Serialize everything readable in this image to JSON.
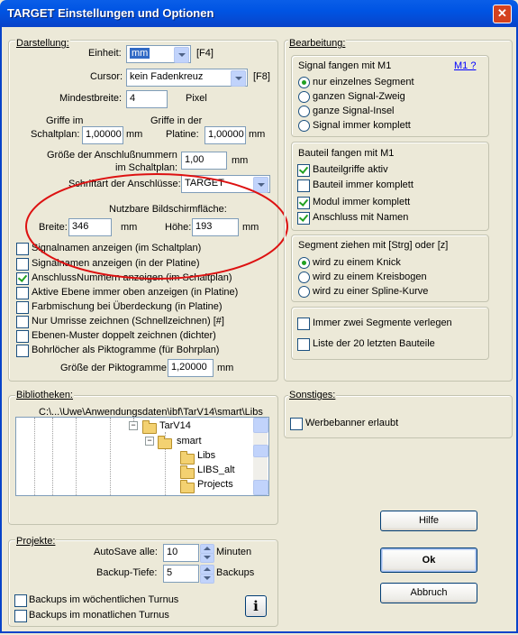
{
  "window": {
    "title": "TARGET Einstellungen und Optionen",
    "close_glyph": "✕"
  },
  "darstellung": {
    "label": "Darstellung:",
    "einheit_label": "Einheit:",
    "einheit_value": "mm",
    "einheit_key": "[F4]",
    "cursor_label": "Cursor:",
    "cursor_value": "kein Fadenkreuz",
    "cursor_key": "[F8]",
    "mindestbreite_label": "Mindestbreite:",
    "mindestbreite_value": "4",
    "mindestbreite_unit": "Pixel",
    "griffe_schaltplan_label1": "Griffe im",
    "griffe_schaltplan_label2": "Schaltplan:",
    "griffe_schaltplan_value": "1,00000",
    "griffe_schaltplan_unit": "mm",
    "griffe_platine_label1": "Griffe in der",
    "griffe_platine_label2": "Platine:",
    "griffe_platine_value": "1,00000",
    "griffe_platine_unit": "mm",
    "anschluss_groesse_label1": "Größe der Anschlußnummern",
    "anschluss_groesse_label2": "im Schaltplan:",
    "anschluss_groesse_value": "1,00",
    "anschluss_groesse_unit": "mm",
    "schriftart_label": "Schriftart der Anschlüsse:",
    "schriftart_value": "TARGET",
    "nutzbar_label": "Nutzbare Bildschirmfläche:",
    "breite_label": "Breite:",
    "breite_value": "346",
    "breite_unit": "mm",
    "hoehe_label": "Höhe:",
    "hoehe_value": "193",
    "hoehe_unit": "mm",
    "checkboxes": [
      {
        "label": "Signalnamen anzeigen (im Schaltplan)",
        "checked": false
      },
      {
        "label": "Signalnamen anzeigen (in der Platine)",
        "checked": false
      },
      {
        "label": "AnschlussNummern anzeigen (im Schaltplan)",
        "checked": true
      },
      {
        "label": "Aktive Ebene immer oben anzeigen (in Platine)",
        "checked": false
      },
      {
        "label": "Farbmischung bei Überdeckung (in Platine)",
        "checked": false
      },
      {
        "label": "Nur Umrisse zeichnen (Schnellzeichnen)  [#]",
        "checked": false
      },
      {
        "label": "Ebenen-Muster doppelt zeichnen (dichter)",
        "checked": false
      },
      {
        "label": "Bohrlöcher als Piktogramme (für Bohrplan)",
        "checked": false
      }
    ],
    "pikto_label": "Größe der Piktogramme:",
    "pikto_value": "1,20000",
    "pikto_unit": "mm"
  },
  "bearbeitung": {
    "label": "Bearbeitung:",
    "signal_title": "Signal fangen mit M1",
    "signal_link": "M1 ?",
    "signal_options": [
      {
        "label": "nur einzelnes Segment",
        "selected": true
      },
      {
        "label": "ganzen Signal-Zweig",
        "selected": false
      },
      {
        "label": "ganze Signal-Insel",
        "selected": false
      },
      {
        "label": "Signal immer komplett",
        "selected": false
      }
    ],
    "bauteil_title": "Bauteil fangen mit M1",
    "bauteil_options": [
      {
        "label": "Bauteilgriffe aktiv",
        "checked": true
      },
      {
        "label": "Bauteil immer komplett",
        "checked": false
      },
      {
        "label": "Modul immer komplett",
        "checked": true
      },
      {
        "label": "Anschluss mit Namen",
        "checked": true
      }
    ],
    "segment_title": "Segment ziehen mit [Strg] oder [z]",
    "segment_options": [
      {
        "label": "wird zu einem Knick",
        "selected": true
      },
      {
        "label": "wird zu einem Kreisbogen",
        "selected": false
      },
      {
        "label": "wird zu einer Spline-Kurve",
        "selected": false
      }
    ],
    "extra_options": [
      {
        "label": "Immer zwei Segmente verlegen",
        "checked": false
      },
      {
        "label": "Liste der 20 letzten Bauteile",
        "checked": false
      }
    ]
  },
  "bibliotheken": {
    "label": "Bibliotheken:",
    "path": "C:\\...\\Uwe\\Anwendungsdaten\\ibf\\TarV14\\smart\\Libs",
    "tree": {
      "expanders": [
        "−",
        "−"
      ],
      "items": [
        {
          "label": "TarV14"
        },
        {
          "label": "smart"
        },
        {
          "label": "Libs"
        },
        {
          "label": "LIBS_alt"
        },
        {
          "label": "Projects"
        }
      ]
    }
  },
  "sonstiges": {
    "label": "Sonstiges:",
    "werbebanner_label": "Werbebanner erlaubt",
    "werbebanner_checked": false
  },
  "projekte": {
    "label": "Projekte:",
    "autosave_label": "AutoSave alle:",
    "autosave_value": "10",
    "autosave_unit": "Minuten",
    "backup_label": "Backup-Tiefe:",
    "backup_value": "5",
    "backup_unit": "Backups",
    "woechentlich_label": "Backups im wöchentlichen Turnus",
    "monatlich_label": "Backups im monatlichen Turnus",
    "info_glyph": "i"
  },
  "buttons": {
    "hilfe": "Hilfe",
    "ok": "Ok",
    "abbruch": "Abbruch"
  },
  "colors": {
    "annotation": "#dd1111",
    "titlebar": "#0054e3",
    "face": "#ece9d8"
  }
}
